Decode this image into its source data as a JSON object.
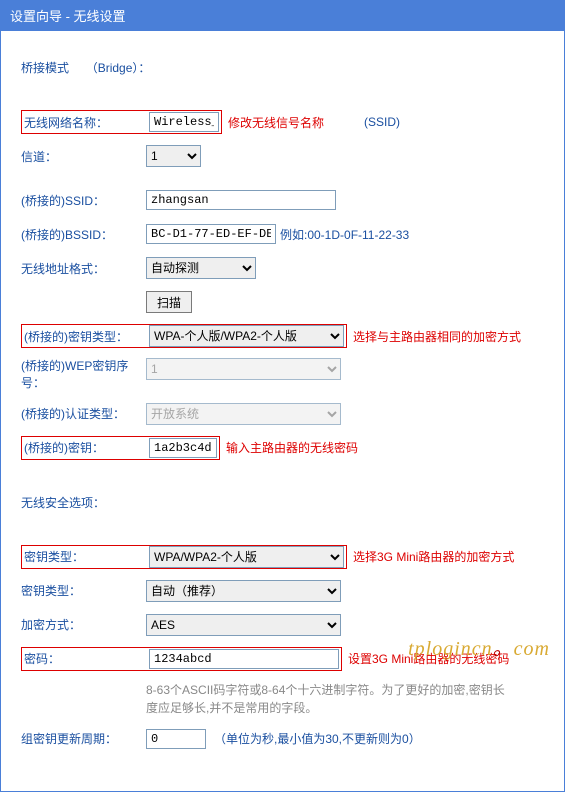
{
  "header": {
    "title": "设置向导 - 无线设置"
  },
  "bridgeMode": {
    "label": "桥接模式",
    "value": "（Bridge）："
  },
  "ssid": {
    "label": "无线网络名称：",
    "value": "Wireless_B",
    "note": "修改无线信号名称",
    "suffix": "(SSID)"
  },
  "channel": {
    "label": "信道：",
    "value": "1"
  },
  "bridgedSsid": {
    "label": "(桥接的)SSID：",
    "value": "zhangsan"
  },
  "bridgedBssid": {
    "label": "(桥接的)BSSID：",
    "value": "BC-D1-77-ED-EF-DE",
    "example": "例如:00-1D-0F-11-22-33"
  },
  "addrFormat": {
    "label": "无线地址格式：",
    "value": "自动探测"
  },
  "scanButton": {
    "label": "扫描"
  },
  "bridgedKeyType": {
    "label": "(桥接的)密钥类型：",
    "value": "WPA-个人版/WPA2-个人版",
    "note": "选择与主路由器相同的加密方式"
  },
  "wepIndex": {
    "label": "(桥接的)WEP密钥序号：",
    "value": "1"
  },
  "authType": {
    "label": "(桥接的)认证类型：",
    "value": "开放系统"
  },
  "bridgedKey": {
    "label": "(桥接的)密钥：",
    "value": "1a2b3c4d",
    "note": "输入主路由器的无线密码"
  },
  "securityOption": {
    "label": "无线安全选项："
  },
  "keyType": {
    "label": "密钥类型：",
    "value": "WPA/WPA2-个人版",
    "note": "选择3G Mini路由器的加密方式"
  },
  "keyType2": {
    "label": "密钥类型：",
    "value": "自动（推荐）"
  },
  "encMethod": {
    "label": "加密方式：",
    "value": "AES"
  },
  "password": {
    "label": "密码：",
    "value": "1234abcd",
    "note": "设置3G Mini路由器的无线密码",
    "hint": "8-63个ASCII码字符或8-64个十六进制字符。为了更好的加密,密钥长度应足够长,并不是常用的字段。"
  },
  "groupKeyPeriod": {
    "label": "组密钥更新周期：",
    "value": "0",
    "suffix": "（单位为秒,最小值为30,不更新则为0）"
  },
  "watermark": {
    "text1": "tplogincn",
    "dot1": "。",
    "text2": "com"
  }
}
